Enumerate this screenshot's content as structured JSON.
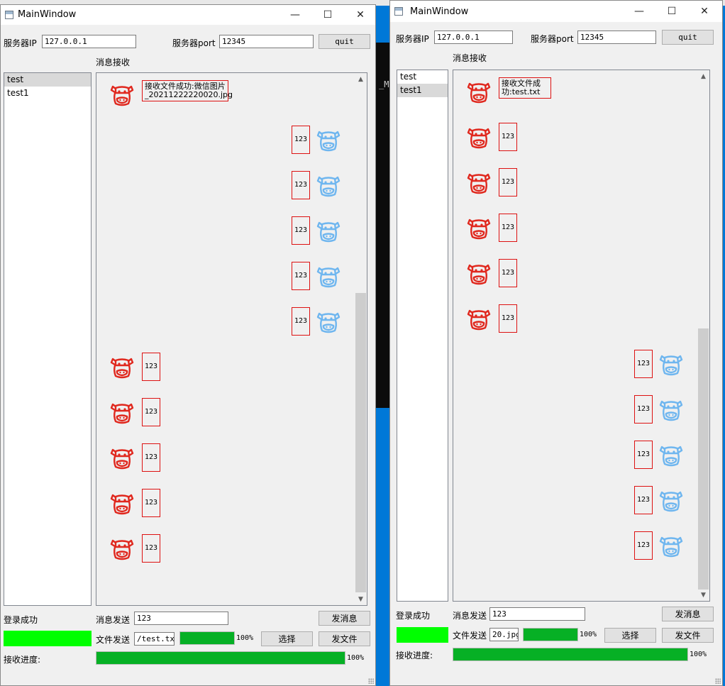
{
  "colors": {
    "login_status": "#00ff00",
    "progress": "#06b025",
    "bubble_border": "#dd1111",
    "cow_red": "#e0281e",
    "cow_blue": "#6fb6ef"
  },
  "background_terminal_text": "_M",
  "windows": [
    {
      "title": "MainWindow",
      "icons": {
        "minimize": "minimize-icon",
        "maximize": "maximize-icon",
        "close": "close-icon"
      },
      "minimize_glyph": "—",
      "maximize_glyph": "☐",
      "close_glyph": "✕",
      "server_ip_label": "服务器IP",
      "server_ip_value": "127.0.0.1",
      "server_port_label": "服务器port",
      "server_port_value": "12345",
      "quit_label": "quit",
      "receive_label": "消息接收",
      "users": [
        {
          "label": "test",
          "selected": true
        },
        {
          "label": "test1",
          "selected": false
        }
      ],
      "messages": [
        {
          "side": "left",
          "avatar": "red-cow-icon",
          "text": "接收文件成功:微信图片_20211222220020.jpg"
        },
        {
          "side": "right",
          "avatar": "blue-cow-icon",
          "text": "123"
        },
        {
          "side": "right",
          "avatar": "blue-cow-icon",
          "text": "123"
        },
        {
          "side": "right",
          "avatar": "blue-cow-icon",
          "text": "123"
        },
        {
          "side": "right",
          "avatar": "blue-cow-icon",
          "text": "123"
        },
        {
          "side": "right",
          "avatar": "blue-cow-icon",
          "text": "123"
        },
        {
          "side": "left",
          "avatar": "red-cow-icon",
          "text": "123"
        },
        {
          "side": "left",
          "avatar": "red-cow-icon",
          "text": "123"
        },
        {
          "side": "left",
          "avatar": "red-cow-icon",
          "text": "123"
        },
        {
          "side": "left",
          "avatar": "red-cow-icon",
          "text": "123"
        },
        {
          "side": "left",
          "avatar": "red-cow-icon",
          "text": "123"
        }
      ],
      "login_status": "登录成功",
      "send_msg_label": "消息发送",
      "send_msg_value": "123",
      "send_msg_button": "发消息",
      "file_send_label": "文件发送",
      "file_path_value": "/test.txt",
      "file_send_progress": 1.0,
      "file_send_pct": "100%",
      "choose_button": "选择",
      "send_file_button": "发文件",
      "recv_progress_label": "接收进度:",
      "recv_progress": 1.0,
      "recv_pct": "100%"
    },
    {
      "title": "MainWindow",
      "icons": {
        "minimize": "minimize-icon",
        "maximize": "maximize-icon",
        "close": "close-icon"
      },
      "minimize_glyph": "—",
      "maximize_glyph": "☐",
      "close_glyph": "✕",
      "server_ip_label": "服务器IP",
      "server_ip_value": "127.0.0.1",
      "server_port_label": "服务器port",
      "server_port_value": "12345",
      "quit_label": "quit",
      "receive_label": "消息接收",
      "users": [
        {
          "label": "test",
          "selected": false
        },
        {
          "label": "test1",
          "selected": true
        }
      ],
      "messages": [
        {
          "side": "left",
          "avatar": "red-cow-icon",
          "text": "接收文件成功:test.txt"
        },
        {
          "side": "left",
          "avatar": "red-cow-icon",
          "text": "123"
        },
        {
          "side": "left",
          "avatar": "red-cow-icon",
          "text": "123"
        },
        {
          "side": "left",
          "avatar": "red-cow-icon",
          "text": "123"
        },
        {
          "side": "left",
          "avatar": "red-cow-icon",
          "text": "123"
        },
        {
          "side": "left",
          "avatar": "red-cow-icon",
          "text": "123"
        },
        {
          "side": "right",
          "avatar": "blue-cow-icon",
          "text": "123"
        },
        {
          "side": "right",
          "avatar": "blue-cow-icon",
          "text": "123"
        },
        {
          "side": "right",
          "avatar": "blue-cow-icon",
          "text": "123"
        },
        {
          "side": "right",
          "avatar": "blue-cow-icon",
          "text": "123"
        },
        {
          "side": "right",
          "avatar": "blue-cow-icon",
          "text": "123"
        }
      ],
      "login_status": "登录成功",
      "send_msg_label": "消息发送",
      "send_msg_value": "123",
      "send_msg_button": "发消息",
      "file_send_label": "文件发送",
      "file_path_value": "20.jpg",
      "file_send_progress": 1.0,
      "file_send_pct": "100%",
      "choose_button": "选择",
      "send_file_button": "发文件",
      "recv_progress_label": "接收进度:",
      "recv_progress": 1.0,
      "recv_pct": "100%"
    }
  ]
}
